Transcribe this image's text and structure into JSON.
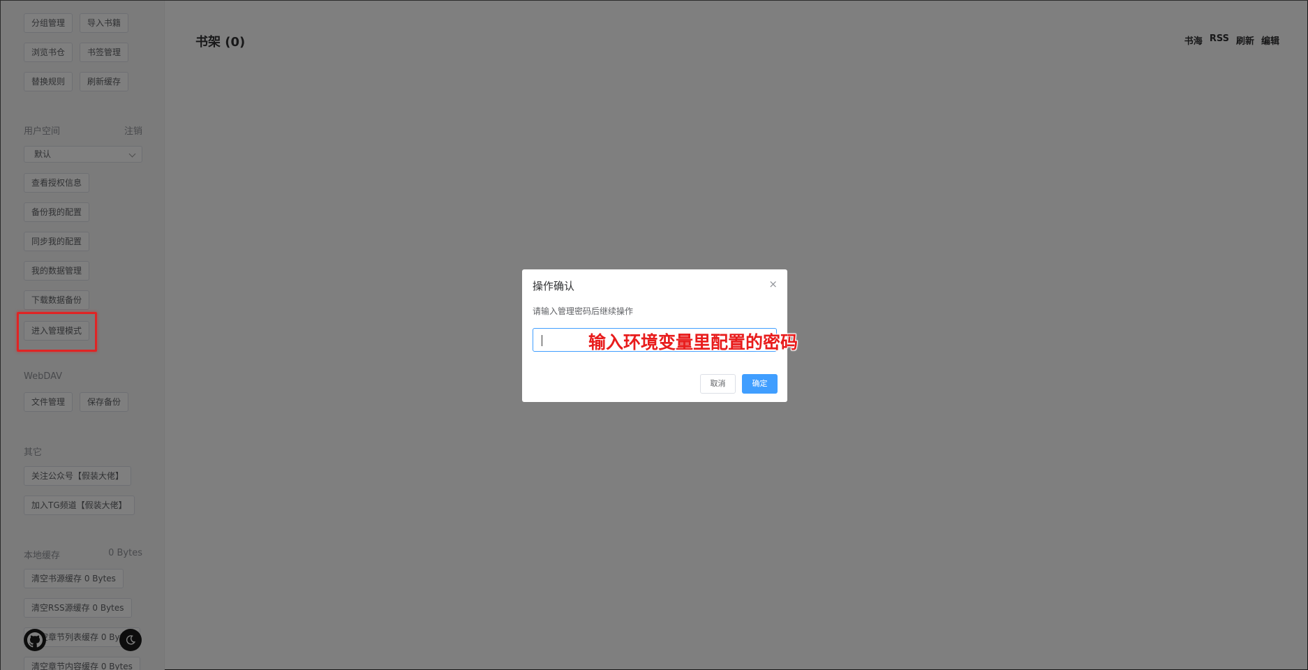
{
  "sidebar": {
    "row1": [
      "分组管理",
      "导入书籍"
    ],
    "row2": [
      "浏览书仓",
      "书签管理"
    ],
    "row3": [
      "替换规则",
      "刷新缓存"
    ],
    "user_space": {
      "label": "用户空间",
      "logout": "注销",
      "select_value": "默认"
    },
    "user_buttons": [
      "查看授权信息",
      "备份我的配置",
      "同步我的配置",
      "我的数据管理",
      "下载数据备份",
      "进入管理模式"
    ],
    "webdav": {
      "label": "WebDAV",
      "buttons": [
        "文件管理",
        "保存备份"
      ]
    },
    "other": {
      "label": "其它",
      "buttons": [
        "关注公众号【假装大佬】",
        "加入TG频道【假装大佬】"
      ]
    },
    "local_cache": {
      "label": "本地缓存",
      "size": "0 Bytes",
      "buttons": [
        "清空书源缓存 0 Bytes",
        "清空RSS源缓存 0 Bytes",
        "清空章节列表缓存 0 Bytes",
        "清空章节内容缓存 0 Bytes"
      ]
    },
    "float_icons": [
      "github-icon",
      "moon-icon"
    ]
  },
  "main": {
    "title": "书架 (0)",
    "links": [
      "书海",
      "RSS",
      "刷新",
      "编辑"
    ]
  },
  "dialog": {
    "title": "操作确认",
    "close": "×",
    "message": "请输入管理密码后继续操作",
    "input_value": "",
    "cancel": "取消",
    "confirm": "确定"
  },
  "annotation": "输入环境变量里配置的密码",
  "colors": {
    "primary": "#409eff",
    "annotation_red": "#e02424",
    "overlay": "rgba(0,0,0,0.5)"
  }
}
